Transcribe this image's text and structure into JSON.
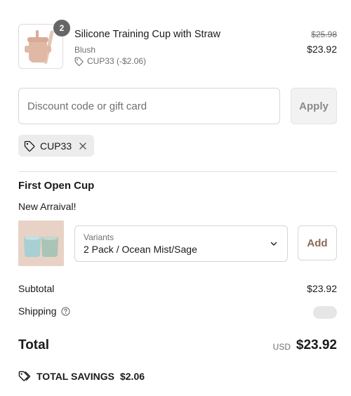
{
  "line_item": {
    "quantity": "2",
    "title": "Silicone Training Cup with Straw",
    "variant": "Blush",
    "discount": "CUP33 (-$2.06)",
    "original_price": "$25.98",
    "price": "$23.92"
  },
  "discount_form": {
    "placeholder": "Discount code or gift card",
    "apply_label": "Apply"
  },
  "applied_code": {
    "code": "CUP33"
  },
  "upsell": {
    "title": "First Open Cup",
    "subtitle": "New Arraival!",
    "variant_label": "Variants",
    "variant_value": "2 Pack / Ocean Mist/Sage",
    "add_label": "Add"
  },
  "summary": {
    "subtotal_label": "Subtotal",
    "subtotal_value": "$23.92",
    "shipping_label": "Shipping",
    "total_label": "Total",
    "currency": "USD",
    "total_value": "$23.92",
    "savings_label": "TOTAL SAVINGS",
    "savings_value": "$2.06"
  },
  "icons": {
    "tag": "tag-icon",
    "close": "close-icon",
    "chevron": "chevron-down-icon",
    "help": "help-circle-icon",
    "savings": "tags-icon"
  },
  "colors": {
    "accent_text": "#8a6a55",
    "badge": "#666666",
    "muted": "#707070"
  }
}
